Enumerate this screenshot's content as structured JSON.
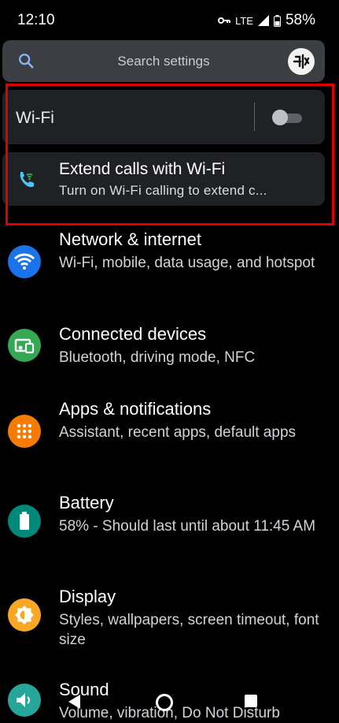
{
  "status_bar": {
    "time": "12:10",
    "network": "LTE",
    "battery": "58%"
  },
  "search": {
    "placeholder": "Search settings"
  },
  "wifi": {
    "label": "Wi-Fi",
    "enabled": false
  },
  "suggestion": {
    "title": "Extend calls with Wi-Fi",
    "subtitle": "Turn on Wi-Fi calling to extend c..."
  },
  "settings": [
    {
      "title": "Network & internet",
      "subtitle": "Wi-Fi, mobile, data usage, and hotspot",
      "icon": "wifi-icon",
      "color": "#1a73e8"
    },
    {
      "title": "Connected devices",
      "subtitle": "Bluetooth, driving mode, NFC",
      "icon": "devices-icon",
      "color": "#34a853"
    },
    {
      "title": "Apps & notifications",
      "subtitle": "Assistant, recent apps, default apps",
      "icon": "apps-grid-icon",
      "color": "#f57c00"
    },
    {
      "title": "Battery",
      "subtitle": "58% - Should last until about 11:45 AM",
      "icon": "battery-icon",
      "color": "#00897b"
    },
    {
      "title": "Display",
      "subtitle": "Styles, wallpapers, screen timeout, font size",
      "icon": "brightness-icon",
      "color": "#f9a825"
    },
    {
      "title": "Sound",
      "subtitle": "Volume, vibration, Do Not Disturb",
      "icon": "volume-icon",
      "color": "#26a69a"
    }
  ]
}
